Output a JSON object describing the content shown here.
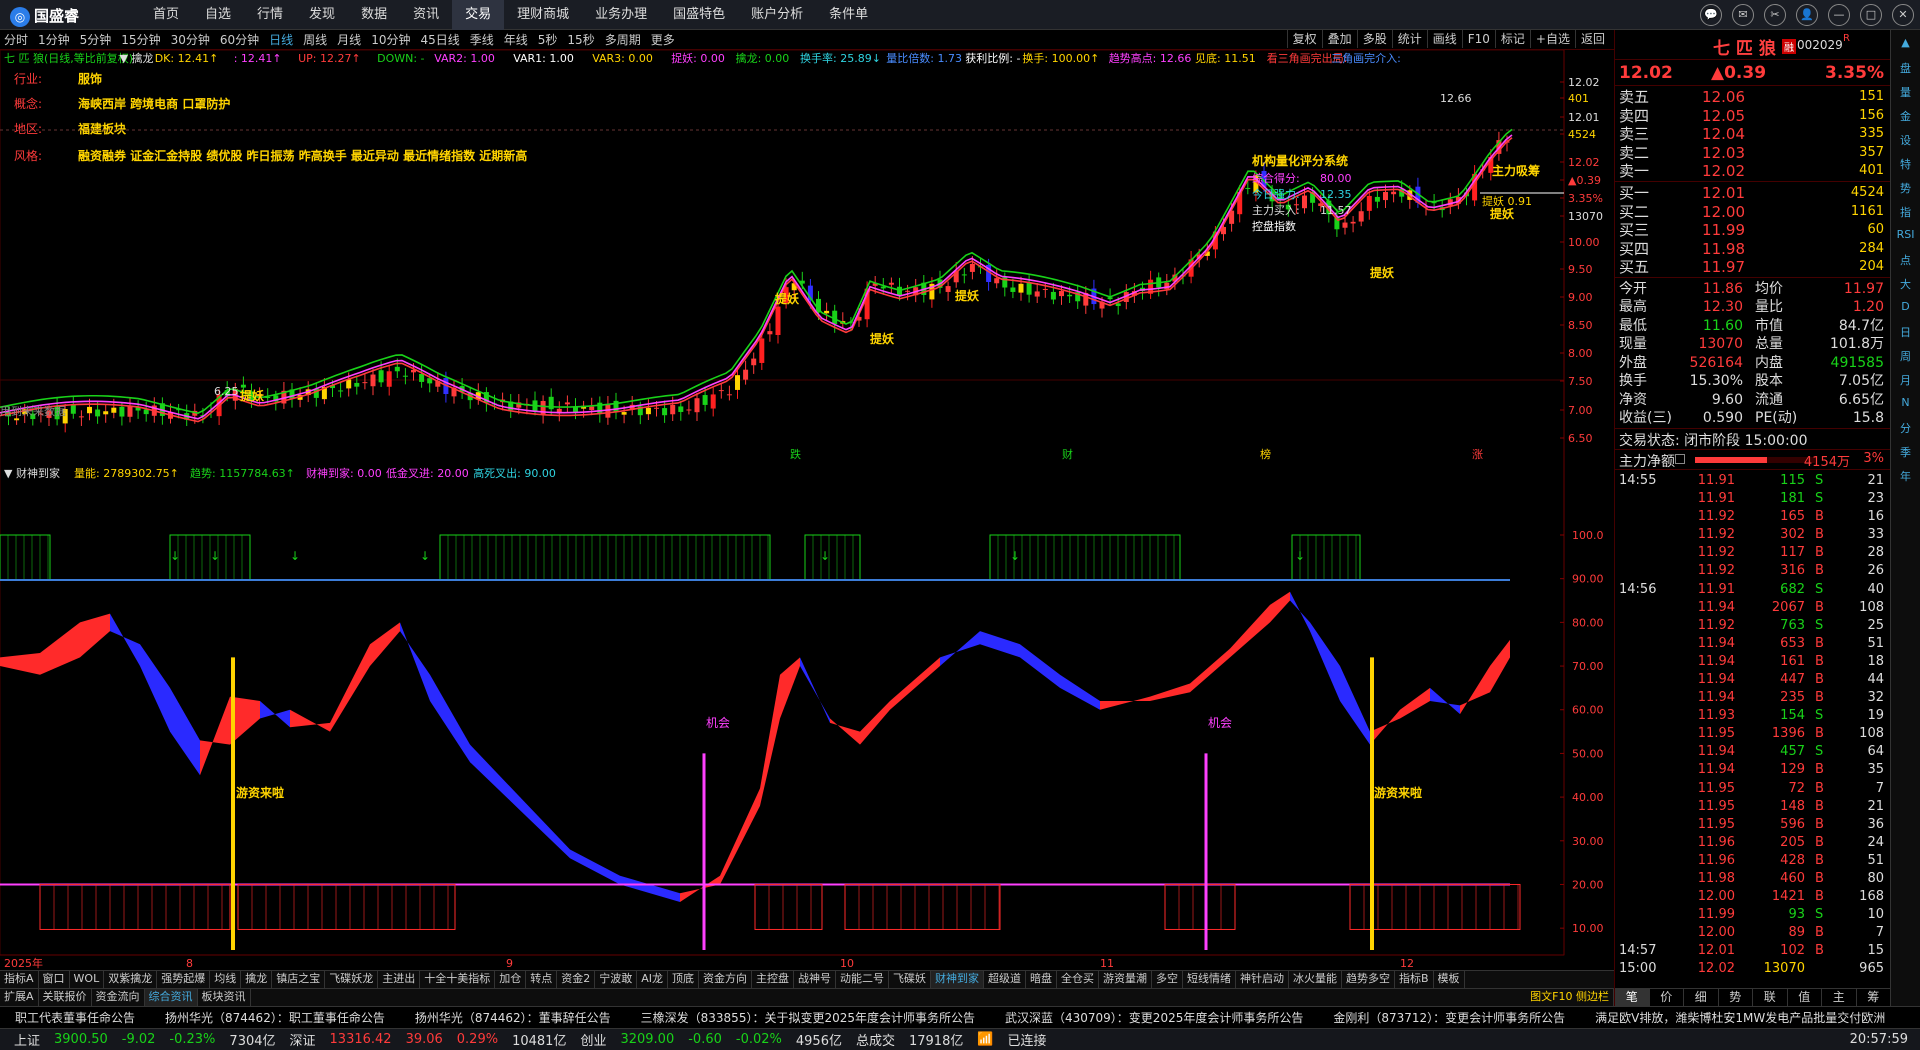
{
  "app": {
    "name": "国盛睿"
  },
  "nav": [
    "首页",
    "自选",
    "行情",
    "发现",
    "数据",
    "资讯",
    "交易",
    "理财商城",
    "业务办理",
    "国盛特色",
    "账户分析",
    "条件单"
  ],
  "nav_active": 6,
  "periods": [
    "分时",
    "1分钟",
    "5分钟",
    "15分钟",
    "30分钟",
    "60分钟",
    "日线",
    "周线",
    "月线",
    "10分钟",
    "45日线",
    "季线",
    "年线",
    "5秒",
    "15秒",
    "多周期",
    "更多"
  ],
  "periods_active": 6,
  "tools": [
    "复权",
    "叠加",
    "多股",
    "统计",
    "画线",
    "F10",
    "标记",
    "+自选",
    "返回"
  ],
  "indicator_line": [
    {
      "t": "七 匹 狼(日线,等比前复权)",
      "c": "#19d219"
    },
    {
      "t": "▼ 擒龙",
      "c": "#ddd"
    },
    {
      "t": "DK: 12.41↑",
      "c": "#ffd400"
    },
    {
      "t": ": 12.41↑",
      "c": "#ff40ff"
    },
    {
      "t": "UP: 12.27↑",
      "c": "#ff3b3b"
    },
    {
      "t": "DOWN: -",
      "c": "#19d219"
    },
    {
      "t": "VAR2: 1.00",
      "c": "#ff40ff"
    },
    {
      "t": "VAR1: 1.00",
      "c": "#fff"
    },
    {
      "t": "VAR3: 0.00",
      "c": "#ffd400"
    },
    {
      "t": "捉妖: 0.00",
      "c": "#ff40ff"
    },
    {
      "t": "擒龙: 0.00",
      "c": "#19d219"
    },
    {
      "t": "换手率: 25.89↓",
      "c": "#2fd3e0"
    },
    {
      "t": "量比倍数: 1.73",
      "c": "#4a8cff"
    },
    {
      "t": "获利比例: -",
      "c": "#fff"
    },
    {
      "t": "换手: 100.00↑",
      "c": "#ffd400"
    },
    {
      "t": "趋势高点: 12.66",
      "c": "#ff40ff"
    },
    {
      "t": "见底: 11.51",
      "c": "#ffd400"
    },
    {
      "t": "看三角画完出局:",
      "c": "#ff3b3b"
    },
    {
      "t": "三角画完介入:",
      "c": "#4a8cff"
    }
  ],
  "info": {
    "industry_label": "行业:",
    "industry": "服饰",
    "concept_label": "概念:",
    "concept": "海峡西岸 跨境电商 口罩防护",
    "region_label": "地区:",
    "region": "福建板块",
    "style_label": "风格:",
    "style": "融资融券 证金汇金持股 绩优股 昨日振荡 昨高换手 最近异动 最近情绪指数 近期新高"
  },
  "quant": {
    "title": "机构量化评分系统",
    "score_label": "综合得分:",
    "score": "80.00",
    "strength_label": "今日强力:",
    "strength": "12.35",
    "buy_label": "主力买入:",
    "buy": "11.57",
    "sell_label": "控盘指数"
  },
  "notes": {
    "future_data": "用到未来数据",
    "high_label": "12.66",
    "main_absorb": "主力吸筹",
    "tiyao_091": "提妖 0.91",
    "low_label": "6.25",
    "axis_marks": [
      "跌",
      "财",
      "榜",
      "涨"
    ]
  },
  "price_axis": [
    {
      "v": "12.02",
      "c": "#ddd"
    },
    {
      "v": "401",
      "c": "#ffd400"
    },
    {
      "v": "12.01",
      "c": "#ddd"
    },
    {
      "v": "4524",
      "c": "#ffd400"
    },
    {
      "v": "12.02",
      "c": "#ff3b3b"
    },
    {
      "v": "▲0.39",
      "c": "#ff3b3b"
    },
    {
      "v": "3.35%",
      "c": "#ff3b3b"
    },
    {
      "v": "13070",
      "c": "#ddd"
    },
    {
      "v": "10.00",
      "c": "#ff3b3b"
    },
    {
      "v": "9.50",
      "c": "#ff3b3b"
    },
    {
      "v": "9.00",
      "c": "#ff3b3b"
    },
    {
      "v": "8.50",
      "c": "#ff3b3b"
    },
    {
      "v": "8.00",
      "c": "#ff3b3b"
    },
    {
      "v": "7.50",
      "c": "#ff3b3b"
    },
    {
      "v": "7.00",
      "c": "#ff3b3b"
    },
    {
      "v": "6.50",
      "c": "#ff3b3b"
    }
  ],
  "sub": {
    "name": "▼ 财神到家",
    "items": [
      {
        "t": "量能: 2789302.75↑",
        "c": "#ffd400"
      },
      {
        "t": "趋势: 1157784.63↑",
        "c": "#19d219"
      },
      {
        "t": "财神到家: 0.00",
        "c": "#ff40ff"
      },
      {
        "t": "低金叉进: 20.00",
        "c": "#ff40ff"
      },
      {
        "t": "高死叉出: 90.00",
        "c": "#2fd3e0"
      }
    ],
    "axis": [
      "100.0",
      "90.00",
      "80.00",
      "70.00",
      "60.00",
      "50.00",
      "40.00",
      "30.00",
      "20.00",
      "10.00"
    ],
    "labels": {
      "youzi": "游资来啦",
      "jihui": "机会"
    }
  },
  "dates": [
    "2025年",
    "8",
    "9",
    "10",
    "11",
    "12"
  ],
  "bottom_tabs": [
    "指标A",
    "窗口",
    "WOL",
    "双紫擒龙",
    "强势起爆",
    "均线",
    "擒龙",
    "镇店之宝",
    "飞碟妖龙",
    "主进出",
    "十全十美指标",
    "加仓",
    "转点",
    "资金2",
    "宁波敢",
    "AI龙",
    "顶底",
    "资金方向",
    "主控盘",
    "战神号",
    "动能二号",
    "飞碟妖",
    "财神到家",
    "超级道",
    "暗盘",
    "全仓买",
    "游资量潮",
    "多空",
    "短线情绪",
    "神针启动",
    "冰火量能",
    "趋势多空",
    "指标B",
    "模板"
  ],
  "bottom_tabs_active": 22,
  "bottom_tabs2": [
    "扩展A",
    "关联报价",
    "资金流向",
    "综合资讯",
    "板块资讯"
  ],
  "bottom_tabs2_active": 3,
  "f10_hint": "图文F10 侧边栏",
  "news": [
    "职工代表董事任命公告",
    "扬州华光（874462）：职工董事任命公告",
    "扬州华光（874462）：董事辞任公告",
    "三橡深发（833855）：关于拟变更2025年度会计师事务所公告",
    "武汉深蓝（430709）：变更2025年度会计师事务所公告",
    "金刚利（873712）：变更会计师事务所公告",
    "满足欧V排放，潍柴博杜安1MW发电产品批量交付欧洲"
  ],
  "status": {
    "sh_label": "上证",
    "sh": "3900.50",
    "sh_chg": "-9.02",
    "sh_pct": "-0.23%",
    "sh_amt": "7304亿",
    "sz_label": "深证",
    "sz": "13316.42",
    "sz_chg": "39.06",
    "sz_pct": "0.29%",
    "sz_amt": "10481亿",
    "cy_label": "创业",
    "cy": "3209.00",
    "cy_chg": "-0.60",
    "cy_pct": "-0.02%",
    "cy_amt": "4956亿",
    "total_label": "总成交",
    "total": "17918亿",
    "conn": "已连接",
    "time": "20:57:59"
  },
  "stock": {
    "name": "七 匹 狼",
    "code": "002029",
    "flag": "R",
    "badge": "融",
    "price": "12.02",
    "change": "▲0.39",
    "pct": "3.35%"
  },
  "sell_book": [
    {
      "l": "卖五",
      "p": "12.06",
      "v": "151"
    },
    {
      "l": "卖四",
      "p": "12.05",
      "v": "156"
    },
    {
      "l": "卖三",
      "p": "12.04",
      "v": "335"
    },
    {
      "l": "卖二",
      "p": "12.03",
      "v": "357"
    },
    {
      "l": "卖一",
      "p": "12.02",
      "v": "401"
    }
  ],
  "buy_book": [
    {
      "l": "买一",
      "p": "12.01",
      "v": "4524"
    },
    {
      "l": "买二",
      "p": "12.00",
      "v": "1161"
    },
    {
      "l": "买三",
      "p": "11.99",
      "v": "60"
    },
    {
      "l": "买四",
      "p": "11.98",
      "v": "284"
    },
    {
      "l": "买五",
      "p": "11.97",
      "v": "204"
    }
  ],
  "stats": [
    [
      {
        "t": "今开",
        "c": "#ddd"
      },
      {
        "t": "11.86",
        "c": "#ff3b3b"
      },
      {
        "t": "均价",
        "c": "#ddd"
      },
      {
        "t": "11.97",
        "c": "#ff3b3b"
      }
    ],
    [
      {
        "t": "最高",
        "c": "#ddd"
      },
      {
        "t": "12.30",
        "c": "#ff3b3b"
      },
      {
        "t": "量比",
        "c": "#ddd"
      },
      {
        "t": "1.20",
        "c": "#ff3b3b"
      }
    ],
    [
      {
        "t": "最低",
        "c": "#ddd"
      },
      {
        "t": "11.60",
        "c": "#19d219"
      },
      {
        "t": "市值",
        "c": "#ddd"
      },
      {
        "t": "84.7亿",
        "c": "#ddd"
      }
    ],
    [
      {
        "t": "现量",
        "c": "#ddd"
      },
      {
        "t": "13070",
        "c": "#ff3b3b"
      },
      {
        "t": "总量",
        "c": "#ddd"
      },
      {
        "t": "101.8万",
        "c": "#ddd"
      }
    ],
    [
      {
        "t": "外盘",
        "c": "#ddd"
      },
      {
        "t": "526164",
        "c": "#ff3b3b"
      },
      {
        "t": "内盘",
        "c": "#ddd"
      },
      {
        "t": "491585",
        "c": "#19d219"
      }
    ],
    [
      {
        "t": "换手",
        "c": "#ddd"
      },
      {
        "t": "15.30%",
        "c": "#ddd"
      },
      {
        "t": "股本",
        "c": "#ddd"
      },
      {
        "t": "7.05亿",
        "c": "#ddd"
      }
    ],
    [
      {
        "t": "净资",
        "c": "#ddd"
      },
      {
        "t": "9.60",
        "c": "#ddd"
      },
      {
        "t": "流通",
        "c": "#ddd"
      },
      {
        "t": "6.65亿",
        "c": "#ddd"
      }
    ],
    [
      {
        "t": "收益(三)",
        "c": "#ddd"
      },
      {
        "t": "0.590",
        "c": "#ddd"
      },
      {
        "t": "PE(动)",
        "c": "#ddd"
      },
      {
        "t": "15.8",
        "c": "#ddd"
      }
    ]
  ],
  "trade_state": {
    "label": "交易状态: 闭市阶段 15:00:00"
  },
  "main_flow": {
    "label": "主力净额",
    "value": "4154万",
    "pct": "3%",
    "fill": 0.6
  },
  "ticks": [
    {
      "t": "14:55",
      "p": "11.91",
      "v": "115",
      "s": "S",
      "n": "21"
    },
    {
      "t": "",
      "p": "11.91",
      "v": "181",
      "s": "S",
      "n": "23"
    },
    {
      "t": "",
      "p": "11.92",
      "v": "165",
      "s": "B",
      "n": "16"
    },
    {
      "t": "",
      "p": "11.92",
      "v": "302",
      "s": "B",
      "n": "33"
    },
    {
      "t": "",
      "p": "11.92",
      "v": "117",
      "s": "B",
      "n": "28"
    },
    {
      "t": "",
      "p": "11.92",
      "v": "316",
      "s": "B",
      "n": "26"
    },
    {
      "t": "14:56",
      "p": "11.91",
      "v": "682",
      "s": "S",
      "n": "40"
    },
    {
      "t": "",
      "p": "11.94",
      "v": "2067",
      "s": "B",
      "n": "108"
    },
    {
      "t": "",
      "p": "11.92",
      "v": "763",
      "s": "S",
      "n": "25"
    },
    {
      "t": "",
      "p": "11.94",
      "v": "653",
      "s": "B",
      "n": "51"
    },
    {
      "t": "",
      "p": "11.94",
      "v": "161",
      "s": "B",
      "n": "18"
    },
    {
      "t": "",
      "p": "11.94",
      "v": "447",
      "s": "B",
      "n": "44"
    },
    {
      "t": "",
      "p": "11.94",
      "v": "235",
      "s": "B",
      "n": "32"
    },
    {
      "t": "",
      "p": "11.93",
      "v": "154",
      "s": "S",
      "n": "19"
    },
    {
      "t": "",
      "p": "11.95",
      "v": "1396",
      "s": "B",
      "n": "108"
    },
    {
      "t": "",
      "p": "11.94",
      "v": "457",
      "s": "S",
      "n": "64"
    },
    {
      "t": "",
      "p": "11.94",
      "v": "129",
      "s": "B",
      "n": "35"
    },
    {
      "t": "",
      "p": "11.95",
      "v": "72",
      "s": "B",
      "n": "7"
    },
    {
      "t": "",
      "p": "11.95",
      "v": "148",
      "s": "B",
      "n": "21"
    },
    {
      "t": "",
      "p": "11.95",
      "v": "596",
      "s": "B",
      "n": "36"
    },
    {
      "t": "",
      "p": "11.96",
      "v": "205",
      "s": "B",
      "n": "24"
    },
    {
      "t": "",
      "p": "11.96",
      "v": "428",
      "s": "B",
      "n": "51"
    },
    {
      "t": "",
      "p": "11.98",
      "v": "460",
      "s": "B",
      "n": "80"
    },
    {
      "t": "",
      "p": "12.00",
      "v": "1421",
      "s": "B",
      "n": "168"
    },
    {
      "t": "",
      "p": "11.99",
      "v": "93",
      "s": "S",
      "n": "10"
    },
    {
      "t": "",
      "p": "12.00",
      "v": "89",
      "s": "B",
      "n": "7"
    },
    {
      "t": "14:57",
      "p": "12.01",
      "v": "102",
      "s": "B",
      "n": "15"
    },
    {
      "t": "15:00",
      "p": "12.02",
      "v": "13070",
      "s": "",
      "n": "965"
    }
  ],
  "rp_tabs": [
    "笔",
    "价",
    "细",
    "势",
    "联",
    "值",
    "主",
    "筹"
  ],
  "rp_tabs_active": 0,
  "side_icons": [
    "▲",
    "盘",
    "量",
    "金",
    "设",
    "特",
    "势",
    "指",
    "RSI",
    "点",
    "大",
    "D",
    "日",
    "周",
    "月",
    "N",
    "分",
    "季",
    "年"
  ],
  "colors": {
    "up": "#ff3b3b",
    "down": "#19d219",
    "yellow": "#ffd400",
    "magenta": "#ff40ff",
    "cyan": "#2fd3e0",
    "blue": "#3030ff"
  }
}
